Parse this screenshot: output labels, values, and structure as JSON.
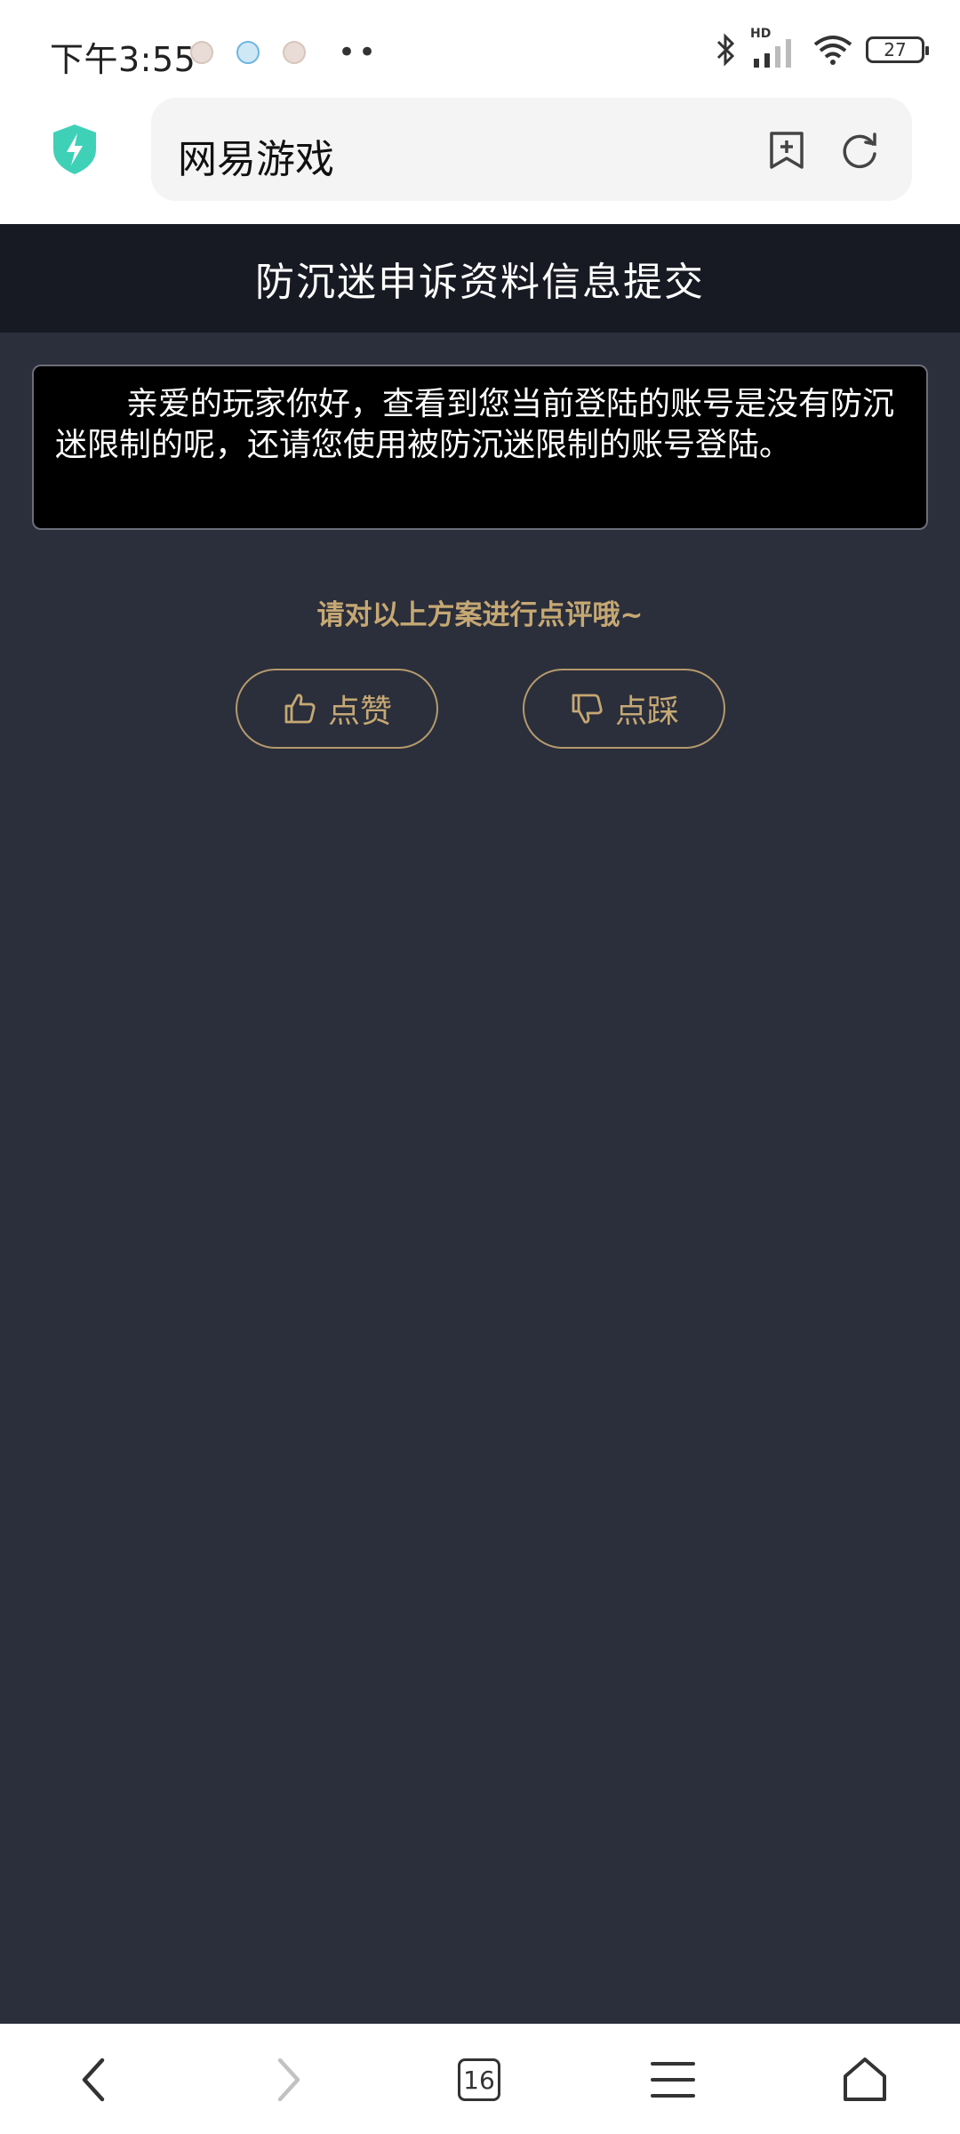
{
  "status_bar": {
    "time": "下午3:55",
    "battery": "27",
    "network_label": "HD",
    "more": "••"
  },
  "browser": {
    "url_title": "网易游戏",
    "tab_count": "16"
  },
  "page": {
    "title": "防沉迷申诉资料信息提交",
    "message": "亲爱的玩家你好，查看到您当前登陆的账号是没有防沉迷限制的呢，还请您使用被防沉迷限制的账号登陆。",
    "rate_prompt": "请对以上方案进行点评哦~",
    "like_label": "点赞",
    "dislike_label": "点踩"
  },
  "colors": {
    "page_bg": "#2b2e3b",
    "header_bg": "#181a23",
    "accent_gold": "#c5a873",
    "shield": "#3fd1b8"
  }
}
